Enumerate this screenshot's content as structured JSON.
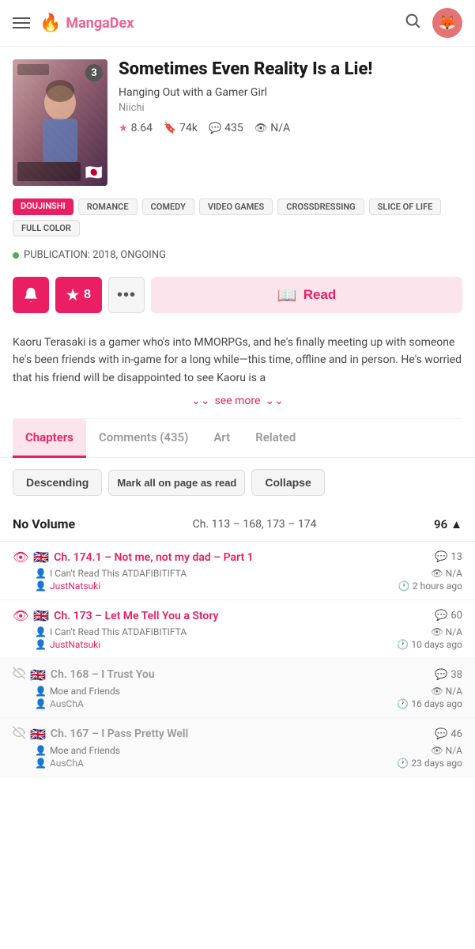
{
  "header": {
    "logo_flame": "🔥",
    "logo_text": "MangaDex",
    "avatar_emoji": "🦊"
  },
  "manga": {
    "title": "Sometimes Even Reality Is a Lie!",
    "subtitle": "Hanging Out with a Gamer Girl",
    "author": "Niichi",
    "cover_badge": "3",
    "rating": "8.64",
    "follows": "74k",
    "comments": "435",
    "views": "N/A",
    "tags": [
      {
        "label": "DOUJINSHI",
        "type": "doujinshi"
      },
      {
        "label": "ROMANCE",
        "type": "genre"
      },
      {
        "label": "COMEDY",
        "type": "genre"
      },
      {
        "label": "VIDEO GAMES",
        "type": "genre"
      },
      {
        "label": "CROSSDRESSING",
        "type": "genre"
      },
      {
        "label": "SLICE OF LIFE",
        "type": "genre"
      },
      {
        "label": "FULL COLOR",
        "type": "genre"
      }
    ],
    "publication": "PUBLICATION: 2018, ONGOING",
    "description": "Kaoru Terasaki is a gamer who's into MMORPGs, and he's finally meeting up with someone he's been friends with in-game for a long while—this time, offline and in person. He's worried that his friend will be disappointed to see Kaoru is a",
    "see_more": "see more"
  },
  "buttons": {
    "bell": "🔔",
    "follow_count": "8",
    "star": "★",
    "more": "•••",
    "book": "📖",
    "read": "Read"
  },
  "tabs": [
    {
      "label": "Chapters",
      "active": true
    },
    {
      "label": "Comments (435)",
      "active": false
    },
    {
      "label": "Art",
      "active": false
    },
    {
      "label": "Related",
      "active": false
    }
  ],
  "filters": {
    "descending": "Descending",
    "mark_all": "Mark all on page as read",
    "collapse": "Collapse"
  },
  "volume": {
    "title": "No Volume",
    "chapters": "Ch. 113 – 168, 173 – 174",
    "count": "96"
  },
  "chapters": [
    {
      "read": true,
      "flag": "🇬🇧",
      "title": "Ch. 174.1 – Not me, not my dad – Part 1",
      "comments": "13",
      "group": "I Can't Read This ATDAFIBITIFTA",
      "views": "N/A",
      "uploader": "JustNatsuki",
      "time": "2 hours ago"
    },
    {
      "read": true,
      "flag": "🇬🇧",
      "title": "Ch. 173 – Let Me Tell You a Story",
      "comments": "60",
      "group": "I Can't Read This ATDAFIBITIFTA",
      "views": "N/A",
      "uploader": "JustNatsuki",
      "time": "10 days ago"
    },
    {
      "read": false,
      "flag": "🇬🇧",
      "title": "Ch. 168 – I Trust You",
      "comments": "38",
      "group": "Moe and Friends",
      "views": "N/A",
      "uploader": "AusChA",
      "time": "16 days ago"
    },
    {
      "read": false,
      "flag": "🇬🇧",
      "title": "Ch. 167 – I Pass Pretty Well",
      "comments": "46",
      "group": "Moe and Friends",
      "views": "N/A",
      "uploader": "AusChA",
      "time": "23 days ago"
    }
  ]
}
